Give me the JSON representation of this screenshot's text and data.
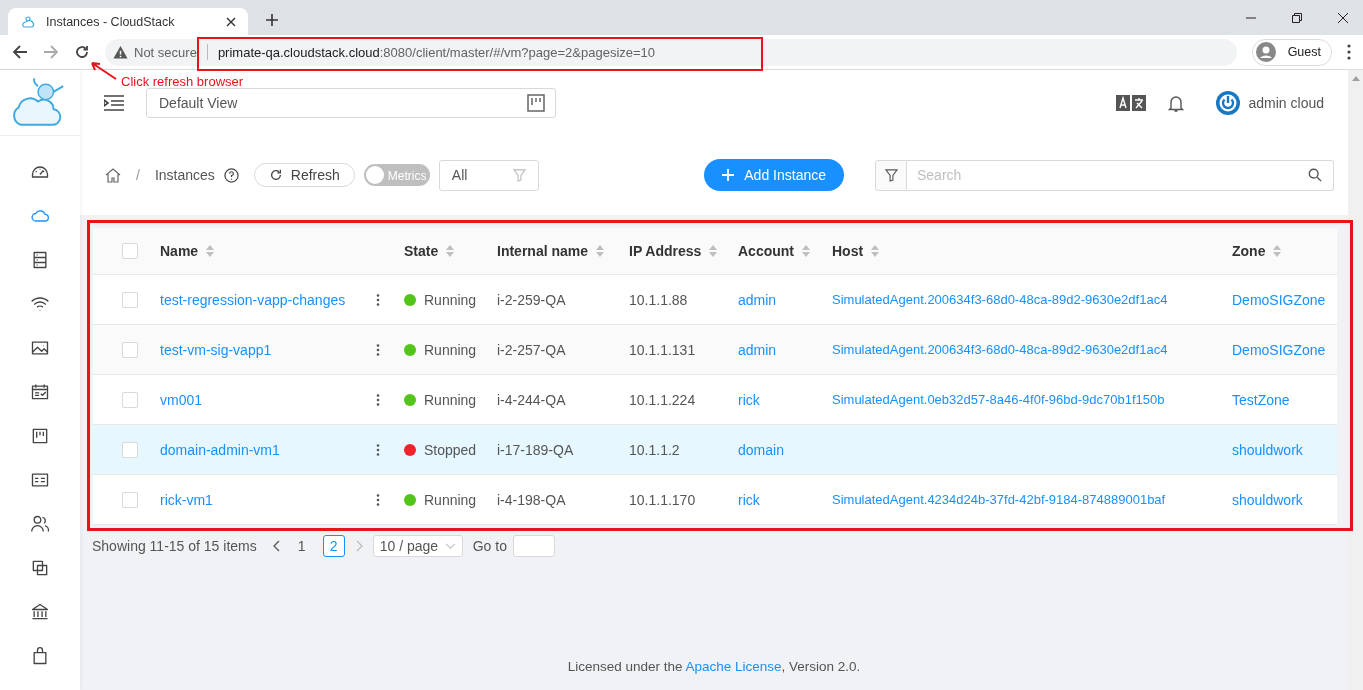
{
  "browser": {
    "tab_title": "Instances - CloudStack",
    "security": "Not secure",
    "url_host": "primate-qa.cloudstack.cloud",
    "url_path": ":8080/client/master/#/vm?page=2&pagesize=10",
    "profile": "Guest"
  },
  "annotation": {
    "text": "Click refresh browser"
  },
  "header": {
    "view": "Default View",
    "user": "admin cloud"
  },
  "sidebar": {
    "items": [
      {
        "selected": false
      },
      {
        "selected": true
      },
      {
        "selected": false
      },
      {
        "selected": false
      },
      {
        "selected": false
      },
      {
        "selected": false
      },
      {
        "selected": false
      },
      {
        "selected": false
      },
      {
        "selected": false
      },
      {
        "selected": false
      },
      {
        "selected": false
      },
      {
        "selected": false
      }
    ]
  },
  "toolbar": {
    "breadcrumb_separator": "/",
    "breadcrumb": "Instances",
    "refresh": "Refresh",
    "metrics": {
      "label": "Metrics",
      "on": false
    },
    "filter": "All",
    "add": "Add Instance",
    "search_placeholder": "Search"
  },
  "table": {
    "all_checked": false,
    "columns": [
      "Name",
      "State",
      "Internal name",
      "IP Address",
      "Account",
      "Host",
      "Zone"
    ],
    "rows": [
      {
        "name": "test-regression-vapp-changes",
        "state": "Running",
        "color": "#52c41a",
        "internal_name": "i-2-259-QA",
        "ip": "10.1.1.88",
        "account": "admin",
        "host": "SimulatedAgent.200634f3-68d0-48ca-89d2-9630e2df1ac4",
        "zone": "DemoSIGZone",
        "highlighted": false,
        "checked": false
      },
      {
        "name": "test-vm-sig-vapp1",
        "state": "Running",
        "color": "#52c41a",
        "internal_name": "i-2-257-QA",
        "ip": "10.1.1.131",
        "account": "admin",
        "host": "SimulatedAgent.200634f3-68d0-48ca-89d2-9630e2df1ac4",
        "zone": "DemoSIGZone",
        "highlighted": false,
        "checked": false
      },
      {
        "name": "vm001",
        "state": "Running",
        "color": "#52c41a",
        "internal_name": "i-4-244-QA",
        "ip": "10.1.1.224",
        "account": "rick",
        "host": "SimulatedAgent.0eb32d57-8a46-4f0f-96bd-9dc70b1f150b",
        "zone": "TestZone",
        "highlighted": false,
        "checked": false
      },
      {
        "name": "domain-admin-vm1",
        "state": "Stopped",
        "color": "#f5222d",
        "internal_name": "i-17-189-QA",
        "ip": "10.1.1.2",
        "account": "domain",
        "zone": "shouldwork",
        "highlighted": true,
        "checked": false
      },
      {
        "name": "rick-vm1",
        "state": "Running",
        "color": "#52c41a",
        "internal_name": "i-4-198-QA",
        "ip": "10.1.1.170",
        "account": "rick",
        "host": "SimulatedAgent.4234d24b-37fd-42bf-9184-874889001baf",
        "zone": "shouldwork",
        "highlighted": false,
        "checked": false
      }
    ]
  },
  "pagination": {
    "summary": "Showing 11-15 of 15 items",
    "pages": [
      {
        "label": "1",
        "selected": false
      },
      {
        "label": "2",
        "selected": true
      }
    ],
    "page_size": "10 / page",
    "goto": "Go to"
  },
  "footer": {
    "before": "Licensed under the ",
    "link": "Apache License",
    "after": ", Version 2.0."
  }
}
